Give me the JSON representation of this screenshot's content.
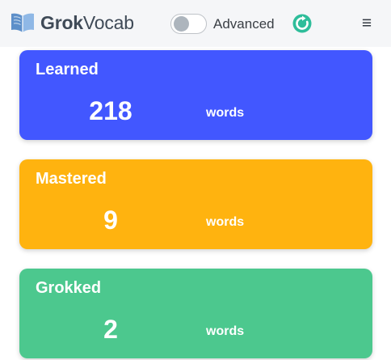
{
  "header": {
    "brand_bold": "Grok",
    "brand_regular": "Vocab",
    "logo_icon": "open-book-icon",
    "advanced_label": "Advanced",
    "advanced_enabled": false,
    "refresh_icon": "refresh-icon",
    "menu_icon": "hamburger-menu-icon",
    "menu_glyph": "≡"
  },
  "cards": [
    {
      "title": "Learned",
      "count": "218",
      "unit": "words",
      "color": "#4257ff"
    },
    {
      "title": "Mastered",
      "count": "9",
      "unit": "words",
      "color": "#ffb30f"
    },
    {
      "title": "Grokked",
      "count": "2",
      "unit": "words",
      "color": "#4cc88e"
    }
  ]
}
